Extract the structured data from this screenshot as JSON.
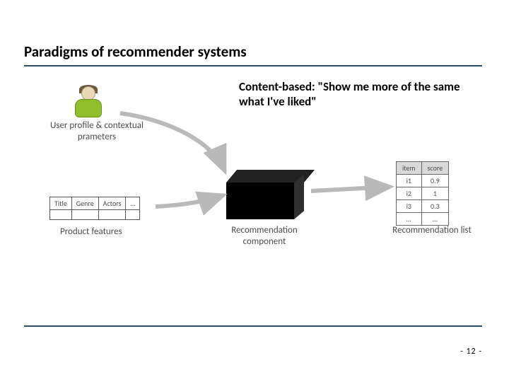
{
  "title": "Paradigms of recommender systems",
  "callout": "Content-based: \"Show me more of the same what I've liked\"",
  "labels": {
    "user": "User profile & contextual prameters",
    "productFeatures": "Product features",
    "component": "Recommendation component",
    "list": "Recommendation list"
  },
  "productFeaturesTable": {
    "headers": [
      "Title",
      "Genre",
      "Actors",
      "…"
    ]
  },
  "recList": {
    "headers": [
      "item",
      "score"
    ],
    "rows": [
      [
        "i1",
        "0.9"
      ],
      [
        "i2",
        "1"
      ],
      [
        "i3",
        "0.3"
      ],
      [
        "…",
        "…"
      ]
    ]
  },
  "pageNumber": "- 12 -"
}
